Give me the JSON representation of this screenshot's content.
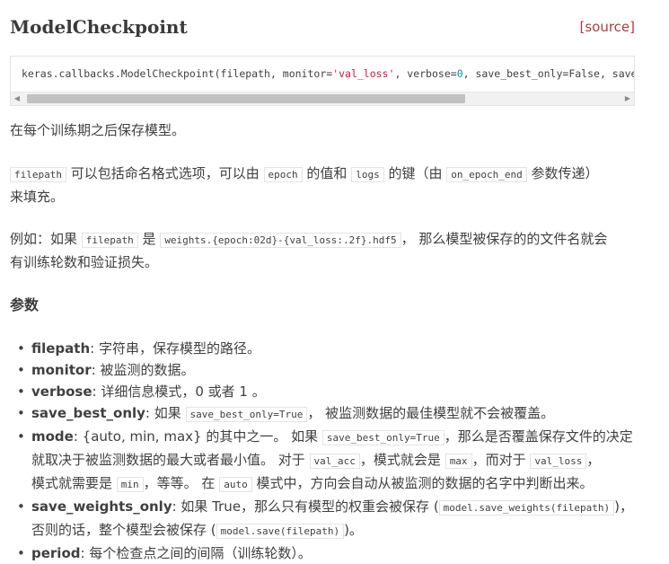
{
  "header": {
    "title": "ModelCheckpoint",
    "source_label": "[source]"
  },
  "signature": {
    "prefix": "keras.callbacks.ModelCheckpoint(filepath, monitor=",
    "monitor_value": "'val_loss'",
    "mid1": ", verbose=",
    "verbose_value": "0",
    "suffix": ", save_best_only=False, save_weig"
  },
  "intro": "在每个训练期之后保存模型。",
  "filepath_desc": {
    "c1": "filepath",
    "t1": " 可以包括命名格式选项，可以由 ",
    "c2": "epoch",
    "t2": " 的值和 ",
    "c3": "logs",
    "t3": " 的键（由 ",
    "c4": "on_epoch_end",
    "t4": " 参数传递）",
    "t5": "来填充。"
  },
  "example": {
    "t1": "例如：如果 ",
    "c1": "filepath",
    "t2": " 是 ",
    "c2": "weights.{epoch:02d}-{val_loss:.2f}.hdf5",
    "t3": "， 那么模型被保存的的文件名就会",
    "t4": "有训练轮数和验证损失。"
  },
  "params_heading": "参数",
  "params": {
    "filepath": {
      "name": "filepath",
      "desc": ": 字符串，保存模型的路径。"
    },
    "monitor": {
      "name": "monitor",
      "desc": ": 被监测的数据。"
    },
    "verbose": {
      "name": "verbose",
      "desc": ": 详细信息模式，0 或者 1 。"
    },
    "save_best_only": {
      "name": "save_best_only",
      "t1": ": 如果 ",
      "c1": "save_best_only=True",
      "t2": "， 被监测数据的最佳模型就不会被覆盖。"
    },
    "mode": {
      "name": "mode",
      "t1": ": {auto, min, max} 的其中之一。 如果 ",
      "c1": "save_best_only=True",
      "t2": "，那么是否覆盖保存文件的决定",
      "t3": "就取决于被监测数据的最大或者最小值。 对于 ",
      "c2": "val_acc",
      "t4": "，模式就会是 ",
      "c3": "max",
      "t5": "，而对于 ",
      "c4": "val_loss",
      "t6": "，",
      "t7": "模式就需要是 ",
      "c5": "min",
      "t8": "，等等。 在 ",
      "c6": "auto",
      "t9": " 模式中，方向会自动从被监测的数据的名字中判断出来。"
    },
    "save_weights_only": {
      "name": "save_weights_only",
      "t1": ": 如果 True，那么只有模型的权重会被保存 (",
      "c1": "model.save_weights(filepath)",
      "t2": ")，",
      "t3": "否则的话，整个模型会被保存 (",
      "c2": "model.save(filepath)",
      "t4": ")。"
    },
    "period": {
      "name": "period",
      "desc": ": 每个检查点之间的间隔（训练轮数）。"
    }
  }
}
